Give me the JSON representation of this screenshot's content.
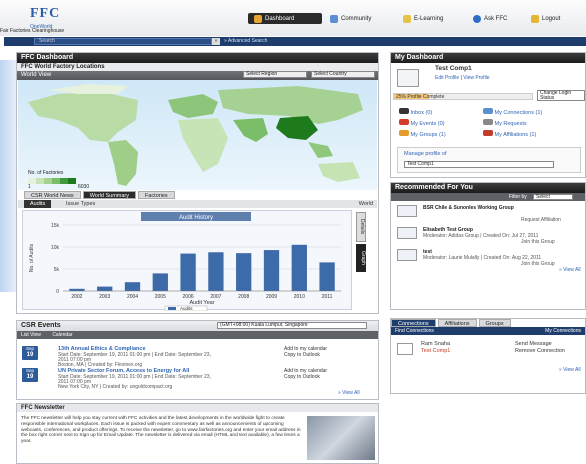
{
  "header": {
    "logo": "FFC",
    "logo_sub": "OneWorld",
    "org_name": "Fair Factories Clearinghouse",
    "nav": [
      {
        "label": "Dashboard"
      },
      {
        "label": "Community"
      },
      {
        "label": "E-Learning"
      },
      {
        "label": "Ask FFC"
      },
      {
        "label": "Logout"
      }
    ]
  },
  "search": {
    "placeholder": "Search",
    "go": "»",
    "advanced": "» Advanced Search"
  },
  "ffc_dashboard": {
    "title": "FFC Dashboard",
    "subtitle": "FFC World Factory Locations",
    "view_label": "World View",
    "select_region": "Select Region",
    "select_country": "Select Country",
    "legend_title": "No. of Factories",
    "legend_min": "1",
    "legend_max": "6030",
    "tabs": [
      "CSR World News",
      "World Summary",
      "Factories"
    ],
    "sub_tabs": [
      "Audits",
      "Issue Types"
    ],
    "scope": "World",
    "side_tab_1": "Details",
    "side_tab_2": "Graph"
  },
  "chart_data": {
    "type": "bar",
    "title": "Audit History",
    "xlabel": "Audit Year",
    "ylabel": "No. of Audits",
    "categories": [
      "2002",
      "2003",
      "2004",
      "2005",
      "2006",
      "2007",
      "2008",
      "2009",
      "2010",
      "2011"
    ],
    "series": [
      {
        "name": "Audits",
        "values": [
          500,
          1000,
          2000,
          4000,
          8500,
          8800,
          8600,
          9300,
          10500,
          6500
        ]
      }
    ],
    "ylim": [
      0,
      15000
    ],
    "yticks": [
      "0",
      "5k",
      "10k",
      "15k"
    ],
    "grid": true,
    "legend": "bottom"
  },
  "csr_events": {
    "title": "CSR Events",
    "timezone": "(GMT+08:00) Kuala Lumpur, Singapore",
    "list_view": "List View",
    "calendar": "Calendar",
    "events": [
      {
        "month": "Sep",
        "day": "19",
        "title": "13th Annual Ethics & Compliance",
        "line1": "Start Date: September 19, 2011 01:00 pm | End Date: September 23,",
        "line2": "2011 07:00 pm",
        "line3": "Boston, MA | Created by: Flexinex.org",
        "add": "Add to my calendar",
        "copy": "Copy to Outlook"
      },
      {
        "month": "Sep",
        "day": "19",
        "title": "UN Private Sector Forum, Access to Energy for All",
        "line1": "Start Date: September 19, 2011 01:00 pm | End Date: September 23,",
        "line2": "2011 07:00 pm",
        "line3": "New York City, NY | Created by: ungoldcompact.org",
        "add": "Add to my calendar",
        "copy": "Copy to Outlook"
      }
    ],
    "view_all": "» View All"
  },
  "newsletter": {
    "title": "FFC Newsletter",
    "text": "The FFC newsletter will help you stay current with FFC activities and the latest developments in the worldwide fight to create responsible international workplaces. Each issue is packed with expert commentary as well as announcements of upcoming webcasts, conferences, and product offerings. To receive the newsletter, go to www.fairfactories.org and enter your email address in the box right corner next to Sign up for Email Update. The newsletter is delivered via email (HTML and text available), a few times a year."
  },
  "my_dashboard": {
    "title": "My Dashboard",
    "name": "Test Comp1",
    "edit_profile": "Edit Profile",
    "view_profile": "View Profile",
    "change_login": "Change Login Status",
    "progress_label": "25% Profile Complete",
    "progress": 0.25,
    "links": [
      {
        "label": "Inbox (0)"
      },
      {
        "label": "My Connections (1)"
      },
      {
        "label": "My Events (0)"
      },
      {
        "label": "My Requests"
      },
      {
        "label": "My Groups (1)"
      },
      {
        "label": "My Affiliations (1)"
      }
    ],
    "manage_label": "Manage profile of",
    "manage_value": "Test Comp1"
  },
  "recommended": {
    "title": "Recommended For You",
    "filter_label": "Filter by",
    "filter_value": "Select",
    "items": [
      {
        "title": "BSR Chile & Sunonles Working Group",
        "meta": "",
        "action": "Request Affiliation"
      },
      {
        "title": "Elisabeth Test Group",
        "meta": "Moderator: Adidas Group | Created On: Jul 27, 2011",
        "action": "Join this Group"
      },
      {
        "title": "test",
        "meta": "Moderator: Laurie Mulally | Created On: Aug 22, 2011",
        "action": "Join this Group"
      }
    ],
    "view_all": "» View All"
  },
  "connections": {
    "tabs": [
      "Connections",
      "Affiliations",
      "Groups"
    ],
    "find": "Find Connections",
    "my_connections": "My Connections",
    "items": [
      {
        "name": "Ram Snaha",
        "company": "Test Comp1",
        "send": "Send Message",
        "remove": "Remove Connection"
      }
    ],
    "view_all": "» View All"
  }
}
